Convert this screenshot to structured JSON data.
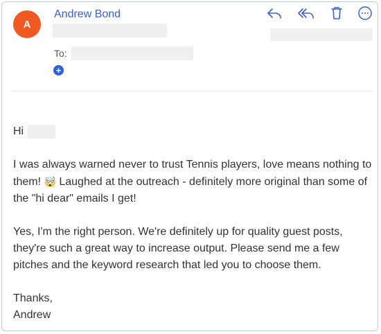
{
  "sender": {
    "avatar_letter": "A",
    "name": "Andrew Bond",
    "avatar_color": "#f05a22"
  },
  "recipient": {
    "to_label": "To:"
  },
  "actions": [
    {
      "icon": "reply-icon"
    },
    {
      "icon": "reply-all-icon"
    },
    {
      "icon": "trash-icon"
    },
    {
      "icon": "more-options-icon"
    }
  ],
  "message": {
    "greeting": "Hi",
    "para1_before": "I was always warned never to trust Tennis players, love means nothing to them!",
    "para1_emoji": "🤯",
    "para1_after": " Laughed at the outreach - definitely more original than some of the \"hi dear\" emails I get!",
    "para2": "Yes, I'm the right person. We're definitely up for quality guest posts, they're such a great way to increase output. Please send me a few pitches and the keyword research that led you to choose them.",
    "signoff": "Thanks,",
    "signature": "Andrew"
  }
}
